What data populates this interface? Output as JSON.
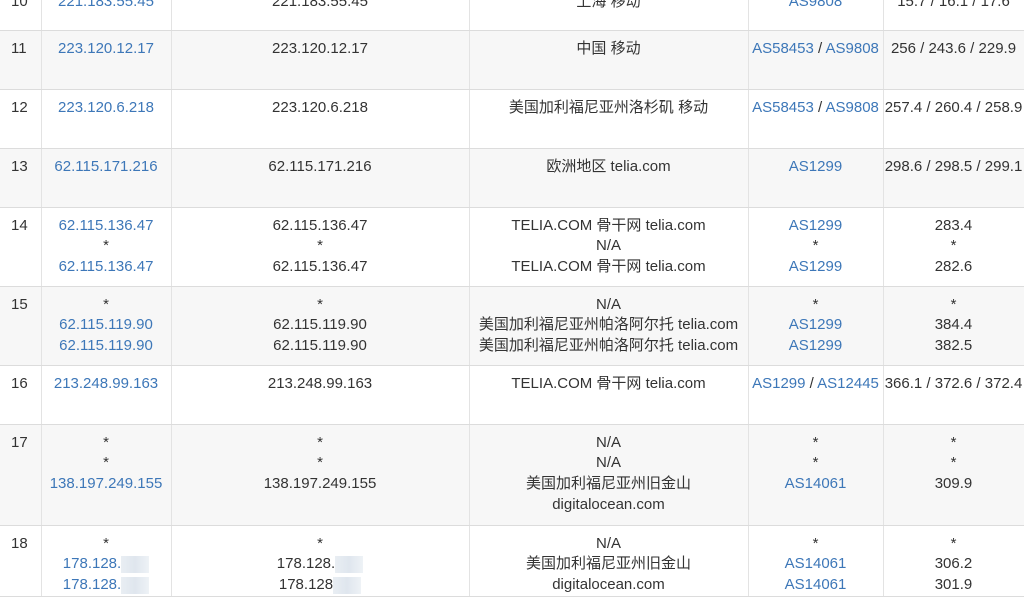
{
  "rows": [
    {
      "hop": "10",
      "ip": [
        "221.183.55.45"
      ],
      "host": [
        "221.183.55.45"
      ],
      "loc": [
        "上海 移动"
      ],
      "as": [
        [
          "AS9808"
        ]
      ],
      "rtt": [
        "15.7 / 16.1 / 17.6"
      ]
    },
    {
      "hop": "11",
      "ip": [
        "223.120.12.17"
      ],
      "host": [
        "223.120.12.17"
      ],
      "loc": [
        "中国 移动"
      ],
      "as": [
        [
          "AS58453",
          "AS9808"
        ]
      ],
      "rtt": [
        "256 / 243.6 / 229.9"
      ]
    },
    {
      "hop": "12",
      "ip": [
        "223.120.6.218"
      ],
      "host": [
        "223.120.6.218"
      ],
      "loc": [
        "美国加利福尼亚州洛杉矶 移动"
      ],
      "as": [
        [
          "AS58453",
          "AS9808"
        ]
      ],
      "rtt": [
        "257.4 / 260.4 / 258.9"
      ]
    },
    {
      "hop": "13",
      "ip": [
        "62.115.171.216"
      ],
      "host": [
        "62.115.171.216"
      ],
      "loc": [
        "欧洲地区 telia.com"
      ],
      "as": [
        [
          "AS1299"
        ]
      ],
      "rtt": [
        "298.6 / 298.5 / 299.1"
      ]
    },
    {
      "hop": "14",
      "ip": [
        "62.115.136.47",
        "*",
        "62.115.136.47"
      ],
      "host": [
        "62.115.136.47",
        "*",
        "62.115.136.47"
      ],
      "loc": [
        "TELIA.COM 骨干网 telia.com",
        "N/A",
        "TELIA.COM 骨干网 telia.com"
      ],
      "as": [
        [
          "AS1299"
        ],
        [
          "*"
        ],
        [
          "AS1299"
        ]
      ],
      "rtt": [
        "283.4",
        "*",
        "282.6"
      ]
    },
    {
      "hop": "15",
      "ip": [
        "*",
        "62.115.119.90",
        "62.115.119.90"
      ],
      "host": [
        "*",
        "62.115.119.90",
        "62.115.119.90"
      ],
      "loc": [
        "N/A",
        "美国加利福尼亚州帕洛阿尔托 telia.com",
        "美国加利福尼亚州帕洛阿尔托 telia.com"
      ],
      "as": [
        [
          "*"
        ],
        [
          "AS1299"
        ],
        [
          "AS1299"
        ]
      ],
      "rtt": [
        "*",
        "384.4",
        "382.5"
      ]
    },
    {
      "hop": "16",
      "ip": [
        "213.248.99.163"
      ],
      "host": [
        "213.248.99.163"
      ],
      "loc": [
        "TELIA.COM 骨干网 telia.com"
      ],
      "as": [
        [
          "AS1299",
          "AS12445"
        ]
      ],
      "rtt": [
        "366.1 / 372.6 / 372.4"
      ]
    },
    {
      "hop": "17",
      "ip": [
        "*",
        "*",
        "138.197.249.155"
      ],
      "host": [
        "*",
        "*",
        "138.197.249.155"
      ],
      "loc": [
        "N/A",
        "N/A",
        "美国加利福尼亚州旧金山",
        "digitalocean.com"
      ],
      "as": [
        [
          "*"
        ],
        [
          "*"
        ],
        [
          "AS14061"
        ]
      ],
      "rtt": [
        "*",
        "*",
        "309.9"
      ]
    },
    {
      "hop": "18",
      "ip": [
        "*",
        "178.128.",
        "178.128."
      ],
      "host": [
        "*",
        "178.128.",
        "178.128"
      ],
      "loc": [
        "N/A",
        "美国加利福尼亚州旧金山",
        "digitalocean.com"
      ],
      "as": [
        [
          "*"
        ],
        [
          "AS14061"
        ],
        [
          "AS14061"
        ]
      ],
      "rtt": [
        "*",
        "306.2",
        "301.9"
      ]
    }
  ],
  "colors": {
    "link": "#3d77b8",
    "text": "#333333",
    "row_alt": "#f7f7f7",
    "border": "#dcdcdc"
  }
}
